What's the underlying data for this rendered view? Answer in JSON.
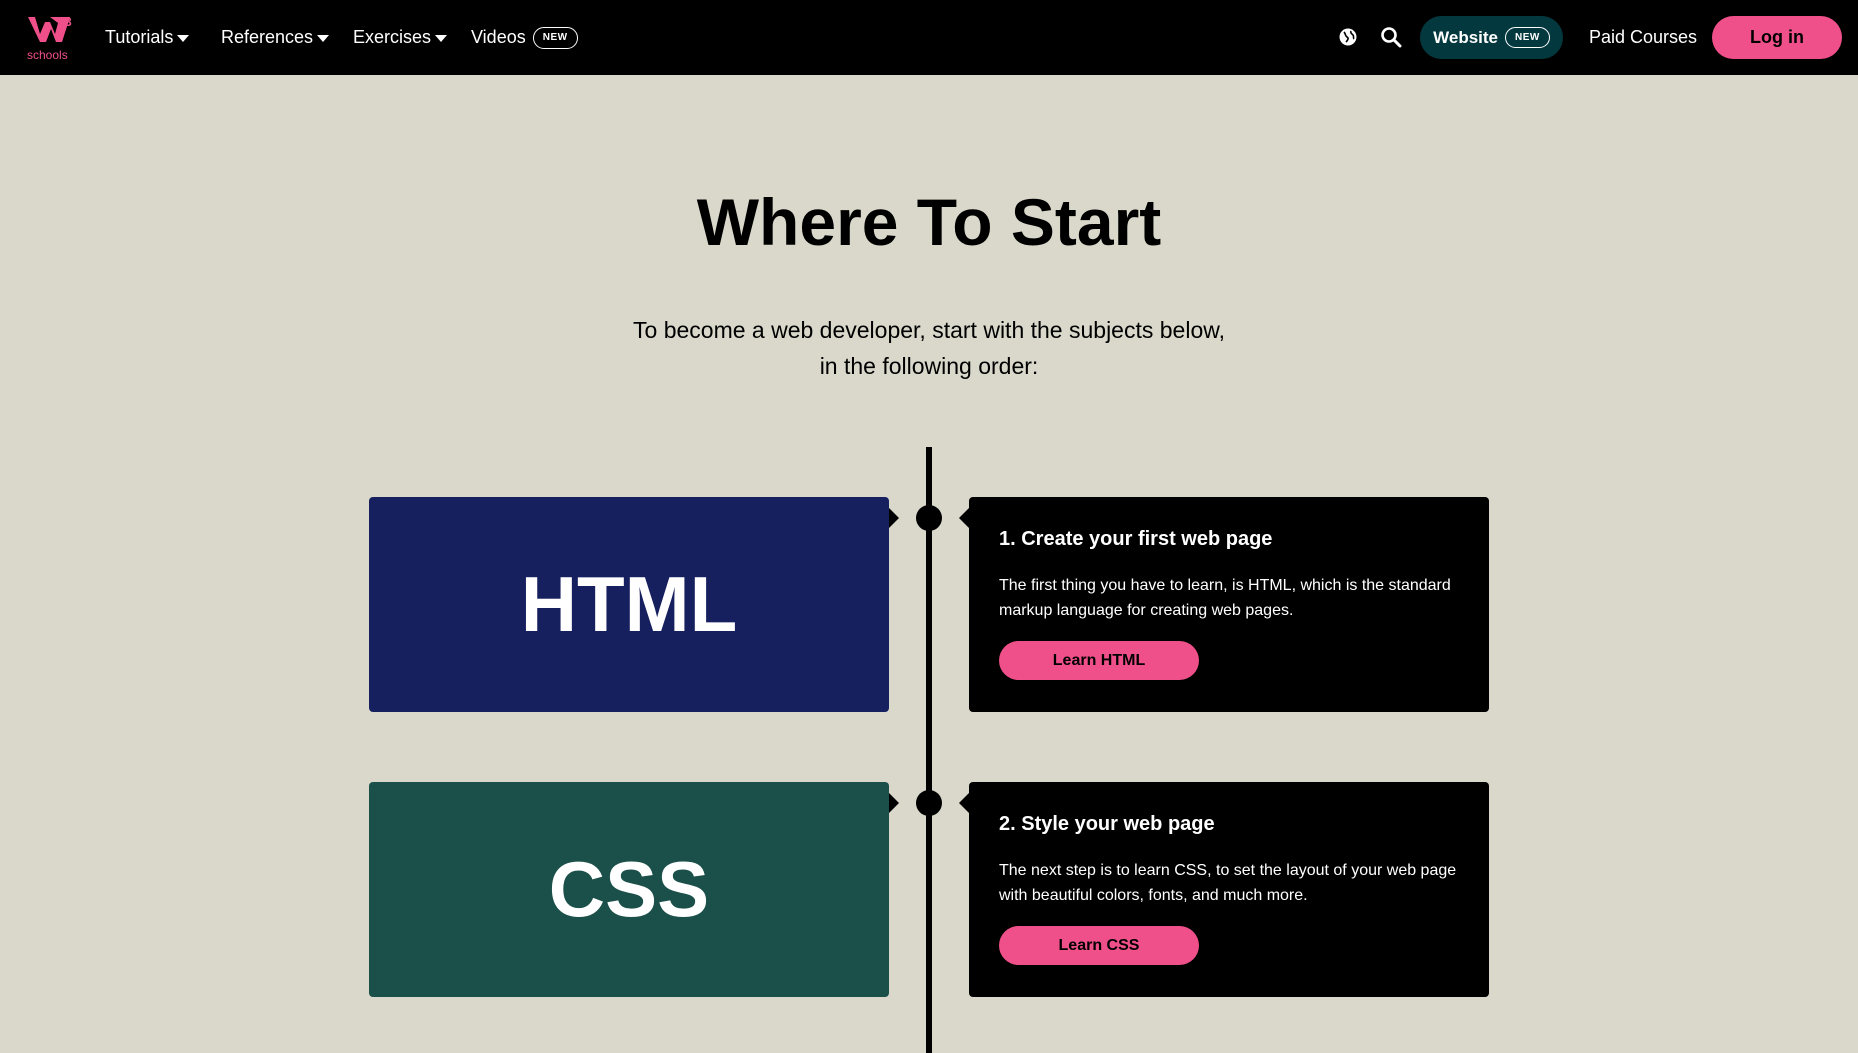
{
  "header": {
    "logo_text": "schools",
    "logo_superscript": "3",
    "nav": [
      {
        "label": "Tutorials"
      },
      {
        "label": "References"
      },
      {
        "label": "Exercises"
      },
      {
        "label": "Videos",
        "badge": "NEW"
      }
    ],
    "globe_icon": "globe-icon",
    "search_icon": "search-icon",
    "website_label": "Website",
    "website_badge": "NEW",
    "paid_courses_label": "Paid Courses",
    "login_label": "Log in"
  },
  "main": {
    "title": "Where To Start",
    "intro_line1": "To become a web developer, start with the subjects below,",
    "intro_line2": "in the following order:",
    "steps": [
      {
        "subject": "HTML",
        "color": "#17205f",
        "title": "1. Create your first web page",
        "text": "The first thing you have to learn, is HTML, which is the standard markup language for creating web pages.",
        "button": "Learn HTML"
      },
      {
        "subject": "CSS",
        "color": "#1a4f4a",
        "title": "2. Style your web page",
        "text": "The next step is to learn CSS, to set the layout of your web page with beautiful colors, fonts, and much more.",
        "button": "Learn CSS"
      }
    ]
  },
  "colors": {
    "accent": "#f0508a",
    "background": "#d9d8cb",
    "website_button": "#04383f"
  }
}
